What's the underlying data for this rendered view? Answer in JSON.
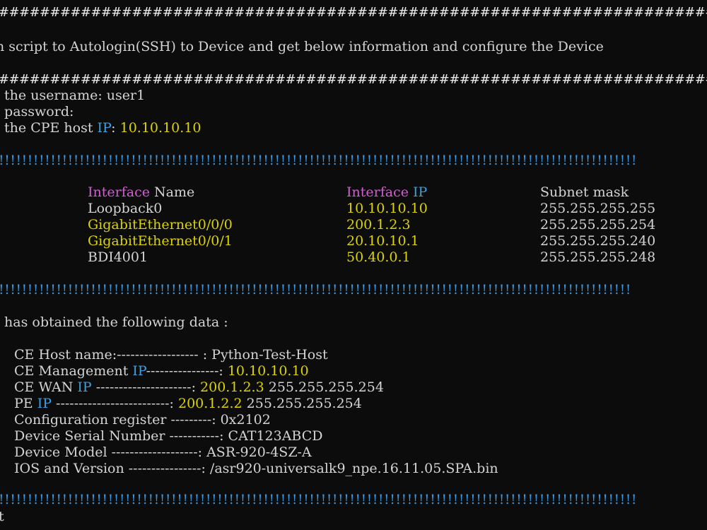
{
  "colors": {
    "background": "#0c0c0c",
    "text": "#d4d4d4",
    "yellow": "#dcd300",
    "cyan": "#3aa0e0",
    "magenta": "#d65cd6"
  },
  "separators": {
    "hash": "##################################################################################################################",
    "bang_1": "!!!!!!!!!!!!!!!!!!!!!!!!!!!!!!!!!!!!!!!!!!!!!!!!!!!!!!!!!!!!!!!!!!!!!!!!!!!!!!!!!!!!!!!!!!!!!!!!!!!!!!!!!!!!!!!",
    "bang_2": "!!!!!!!!!!!!!!!!!!!!!!!!!!!!!!!!!!!!!!!!!!!!!!!!!!!!!!!!!!!!!!!!!!!!!!!!!!!!!!!!!!!!!!!!!!!!!!!!!!!!!!!!!!!!!!",
    "bang_3": "!!!!!!!!!!!!!!!!!!!!!!!!!!!!!!!!!!!!!!!!!!!!!!!!!!!!!!!!!!!!!!!!!!!!!!!!!!!!!!!!!!!!!!!!!!!!!!!!!!!!!!!!!!!!!!!"
  },
  "banner": "n script to Autologin(SSH) to Device and get below information and configure the Device",
  "prompts": {
    "username_label": " the username: ",
    "username_value": "user1",
    "password_label": " password:",
    "host_label_a": " the CPE host ",
    "host_label_ip": "IP",
    "host_label_b": ": ",
    "host_value": "10.10.10.10"
  },
  "interfaces": {
    "headers": {
      "name_a": "Interface",
      "name_b": " Name",
      "ip_a": "Interface",
      "ip_b": " IP",
      "mask": "Subnet mask"
    },
    "rows": [
      {
        "name": "Loopback0",
        "ip": "10.10.10.10",
        "mask": "255.255.255.255"
      },
      {
        "name": "GigabitEthernet0/0/0",
        "ip": "200.1.2.3",
        "mask": "255.255.255.254"
      },
      {
        "name": "GigabitEthernet0/0/1",
        "ip": "20.10.10.1",
        "mask": "255.255.255.240"
      },
      {
        "name": "BDI4001",
        "ip": "50.40.0.1",
        "mask": "255.255.255.248"
      }
    ]
  },
  "obtained_line": " has obtained the following data :",
  "summary": [
    {
      "label_a": "CE Host name:------------------ : ",
      "label_ip": "",
      "label_b": "",
      "value": "Python-Test-Host",
      "value_color": "w",
      "extra": ""
    },
    {
      "label_a": "CE Management ",
      "label_ip": "IP",
      "label_b": "----------------: ",
      "value": "10.10.10.10",
      "value_color": "y",
      "extra": ""
    },
    {
      "label_a": "CE WAN ",
      "label_ip": "IP",
      "label_b": " ---------------------: ",
      "value": "200.1.2.3",
      "value_color": "y",
      "extra": " 255.255.255.254"
    },
    {
      "label_a": "PE ",
      "label_ip": "IP",
      "label_b": " -------------------------: ",
      "value": "200.1.2.2",
      "value_color": "y",
      "extra": " 255.255.255.254"
    },
    {
      "label_a": "Configuration register ---------: ",
      "label_ip": "",
      "label_b": "",
      "value": "0x2102",
      "value_color": "w",
      "extra": ""
    },
    {
      "label_a": "Device Serial Number -----------: ",
      "label_ip": "",
      "label_b": "",
      "value": "CAT123ABCD",
      "value_color": "w",
      "extra": ""
    },
    {
      "label_a": "Device Model -------------------: ",
      "label_ip": "",
      "label_b": "",
      "value": "ASR-920-4SZ-A",
      "value_color": "w",
      "extra": ""
    },
    {
      "label_a": "IOS and Version ----------------: ",
      "label_ip": "",
      "label_b": "",
      "value": "/asr920-universalk9_npe.16.11.05.SPA.bin",
      "value_color": "w",
      "extra": ""
    }
  ],
  "last_line": "t"
}
